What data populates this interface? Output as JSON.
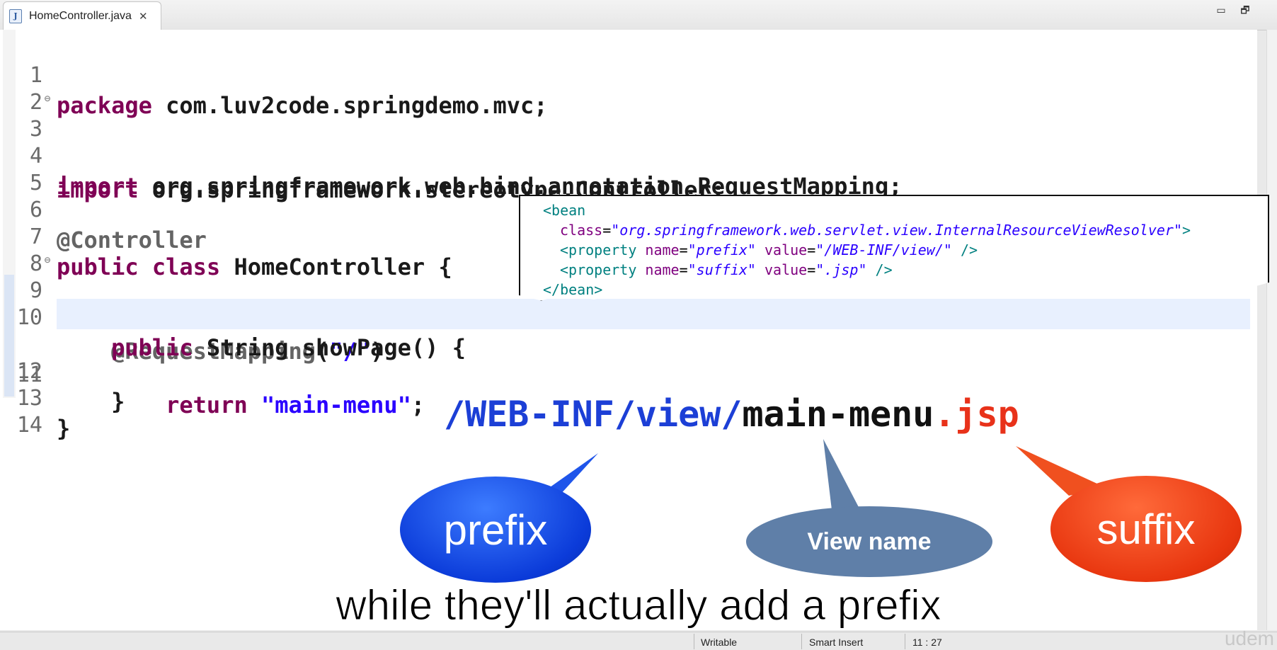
{
  "tab": {
    "title": "HomeController.java",
    "icon_letter": "J",
    "close_glyph": "✕"
  },
  "window": {
    "minimize_glyph": "▭",
    "restore_glyph": "🗗"
  },
  "code": {
    "line_numbers": [
      "1",
      "2",
      "3",
      "4",
      "5",
      "6",
      "7",
      "8",
      "9",
      "10",
      "11",
      "12",
      "13",
      "14"
    ],
    "l1_kw": "package",
    "l1_rest": " com.luv2code.springdemo.mvc;",
    "l3_kw": "import",
    "l3_rest": " org.springframework.stereotype.Controller;",
    "l4_kw": "import",
    "l4_rest": " org.springframework.web.bind.annotation.RequestMapping;",
    "l6_anno": "@Controller",
    "l7_kw": "public class",
    "l7_rest": " HomeController {",
    "l9_anno": "    @RequestMapping",
    "l9_p1": "(",
    "l9_str": "\"/\"",
    "l9_p2": ")",
    "l10_kw": "    public",
    "l10_rest": " String showPage() {",
    "l11_kw": "        return",
    "l11_sp": " ",
    "l11_str": "\"main-menu\"",
    "l11_end": ";",
    "l12": "    }",
    "l13": "}"
  },
  "callout": {
    "x1": "<bean",
    "x2_attr": "class",
    "x2_eq": "=",
    "x2_val": "\"org.springframework.web.servlet.view.InternalResourceViewResolver\"",
    "x2_end": ">",
    "x3_tag": "<property",
    "x3_a1": " name",
    "x3_eq1": "=",
    "x3_v1": "\"prefix\"",
    "x3_a2": " value",
    "x3_eq2": "=",
    "x3_v2": "\"/WEB-INF/view/\"",
    "x3_end": " />",
    "x4_tag": "<property",
    "x4_a1": " name",
    "x4_eq1": "=",
    "x4_v1": "\"suffix\"",
    "x4_a2": " value",
    "x4_eq2": "=",
    "x4_v2": "\".jsp\"",
    "x4_end": " />",
    "x5": "</bean>"
  },
  "path": {
    "prefix": "/WEB-INF/view/",
    "view": "main-menu",
    "suffix": ".jsp"
  },
  "bubbles": {
    "prefix": "prefix",
    "view": "View name",
    "suffix": "suffix"
  },
  "subtitle": "while they'll actually add a prefix",
  "status": {
    "writable": "Writable",
    "insert": "Smart Insert",
    "position": "11 : 27"
  },
  "watermark": "udem",
  "colors": {
    "keyword": "#7f0055",
    "string": "#2a00ff",
    "prefix_blue": "#1c3fd6",
    "suffix_red": "#e8321a",
    "view_bubble": "#5f7fa8"
  }
}
